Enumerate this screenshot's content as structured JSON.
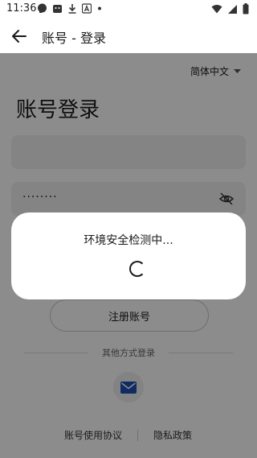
{
  "status_bar": {
    "time": "11:36",
    "left_icons": [
      "chat-bubble-icon",
      "app-notification-icon",
      "download-icon",
      "a-icon",
      "dot-icon"
    ],
    "right_icons": [
      "wifi-icon",
      "signal-icon",
      "battery-icon"
    ]
  },
  "app_bar": {
    "title": "账号 - 登录"
  },
  "login": {
    "language": "简体中文",
    "page_title": "账号登录",
    "account_value": "",
    "password_value": "········",
    "register_label": "注册账号",
    "other_methods_label": "其他方式登录",
    "agreement_link": "账号使用协议",
    "privacy_link": "隐私政策"
  },
  "dialog": {
    "message": "环境安全检测中..."
  },
  "colors": {
    "overlay": "#737373",
    "accent_mail": "#1e4fb4"
  }
}
